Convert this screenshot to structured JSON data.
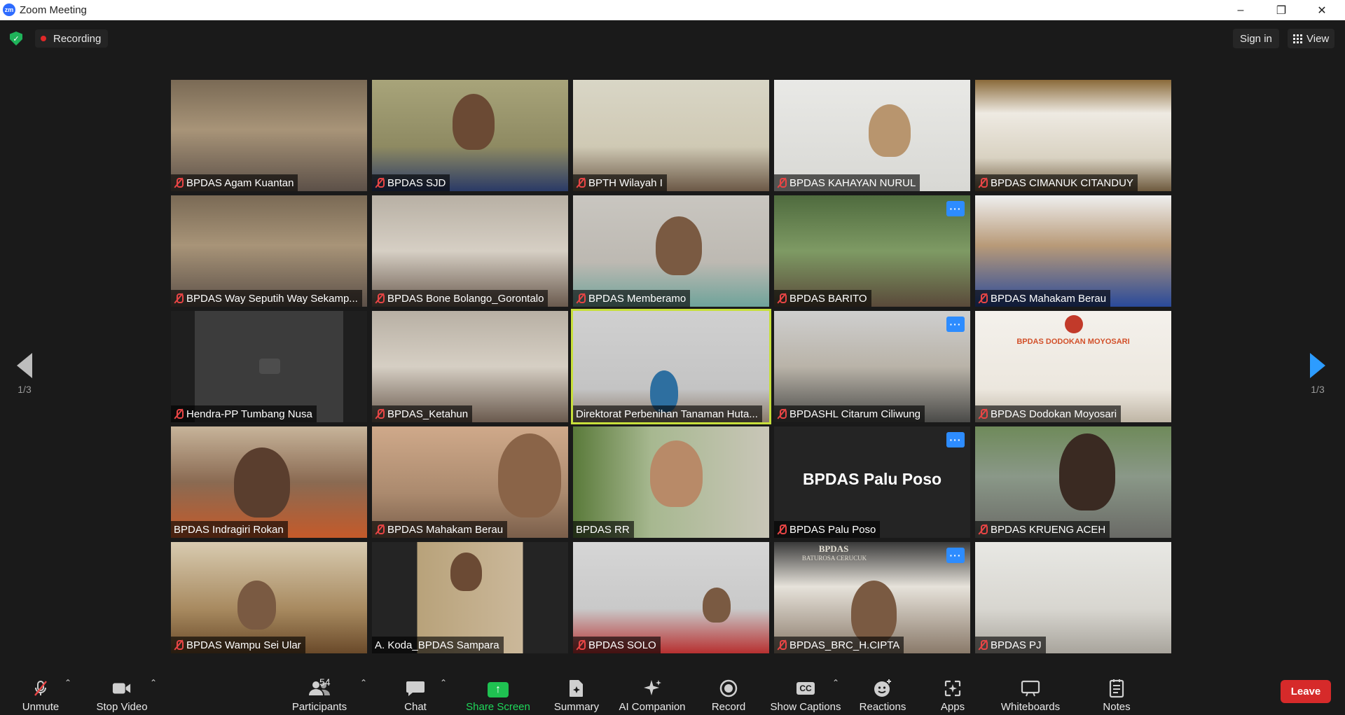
{
  "window": {
    "title": "Zoom Meeting",
    "app_badge": "zm"
  },
  "topbar": {
    "recording_label": "Recording",
    "signin_label": "Sign in",
    "view_label": "View"
  },
  "pager": {
    "left_label": "1/3",
    "right_label": "1/3"
  },
  "participants": [
    {
      "name": "BPDAS Agam Kuantan",
      "muted": true,
      "scene": "office",
      "more": false,
      "active": false
    },
    {
      "name": "BPDAS SJD",
      "muted": true,
      "scene": "face-olive",
      "more": false,
      "active": false
    },
    {
      "name": "BPTH Wilayah I",
      "muted": true,
      "scene": "meeting-wall",
      "more": false,
      "active": false
    },
    {
      "name": "BPDAS KAHAYAN NURUL",
      "muted": true,
      "scene": "face-white",
      "more": false,
      "active": false
    },
    {
      "name": "BPDAS CIMANUK CITANDUY",
      "muted": true,
      "scene": "hall",
      "more": false,
      "active": false
    },
    {
      "name": "BPDAS Way Seputih Way Sekamp...",
      "muted": true,
      "scene": "office",
      "more": false,
      "active": false
    },
    {
      "name": "BPDAS Bone Bolango_Gorontalo",
      "muted": true,
      "scene": "meeting-long",
      "more": false,
      "active": false
    },
    {
      "name": "BPDAS Memberamo",
      "muted": true,
      "scene": "face-headset",
      "more": false,
      "active": false
    },
    {
      "name": "BPDAS BARITO",
      "muted": true,
      "scene": "forest",
      "more": true,
      "active": false
    },
    {
      "name": "BPDAS Mahakam Berau",
      "muted": true,
      "scene": "hall-blue",
      "more": false,
      "active": false
    },
    {
      "name": "Hendra-PP Tumbang Nusa",
      "muted": true,
      "scene": "blank",
      "more": false,
      "active": false
    },
    {
      "name": "BPDAS_Ketahun",
      "muted": true,
      "scene": "meeting-long",
      "more": false,
      "active": false
    },
    {
      "name": "Direktorat Perbenihan Tanaman Huta...",
      "muted": false,
      "scene": "face-hijab",
      "more": false,
      "active": true
    },
    {
      "name": "BPDASHL Citarum Ciliwung",
      "muted": true,
      "scene": "meeting-flowers",
      "more": true,
      "active": false
    },
    {
      "name": "BPDAS Dodokan Moyosari",
      "muted": true,
      "scene": "wall-logo",
      "more": false,
      "active": false
    },
    {
      "name": "BPDAS Indragiri Rokan",
      "muted": false,
      "scene": "face-orange",
      "more": false,
      "active": false
    },
    {
      "name": "BPDAS Mahakam Berau",
      "muted": true,
      "scene": "face-glasses",
      "more": false,
      "active": false
    },
    {
      "name": "BPDAS RR",
      "muted": false,
      "scene": "face-curtain",
      "more": false,
      "active": false
    },
    {
      "name": "BPDAS Palu Poso",
      "muted": true,
      "scene": "text",
      "more": true,
      "active": false,
      "display_text": "BPDAS Palu Poso"
    },
    {
      "name": "BPDAS KRUENG ACEH",
      "muted": true,
      "scene": "river",
      "more": false,
      "active": false
    },
    {
      "name": "BPDAS Wampu Sei Ular",
      "muted": true,
      "scene": "face-mask",
      "more": false,
      "active": false
    },
    {
      "name": "A. Koda_BPDAS Sampara",
      "muted": false,
      "scene": "portrait",
      "more": false,
      "active": false
    },
    {
      "name": "BPDAS SOLO",
      "muted": true,
      "scene": "face-red",
      "more": false,
      "active": false
    },
    {
      "name": "BPDAS_BRC_H.CIPTA",
      "muted": true,
      "scene": "face-sign",
      "more": true,
      "active": false
    },
    {
      "name": "BPDAS PJ",
      "muted": true,
      "scene": "office-projector",
      "more": false,
      "active": false
    }
  ],
  "scene_texts": {
    "wall_logo": "BPDAS DODOKAN MOYOSARI",
    "sign_line1": "BPDAS",
    "sign_line2": "BATUROSA CERUCUK"
  },
  "toolbar": {
    "unmute": "Unmute",
    "stop_video": "Stop Video",
    "participants": "Participants",
    "participant_count": "54",
    "chat": "Chat",
    "share_screen": "Share Screen",
    "summary": "Summary",
    "ai_companion": "AI Companion",
    "record": "Record",
    "show_captions": "Show Captions",
    "captions_badge": "CC",
    "reactions": "Reactions",
    "apps": "Apps",
    "whiteboards": "Whiteboards",
    "notes": "Notes",
    "leave": "Leave"
  },
  "colors": {
    "background": "#1a1a1a",
    "active_speaker": "#c7df3b",
    "accent_blue": "#2d8cff",
    "share_green": "#1fc151",
    "leave_red": "#d62a2a",
    "muted_red": "#e84545"
  }
}
